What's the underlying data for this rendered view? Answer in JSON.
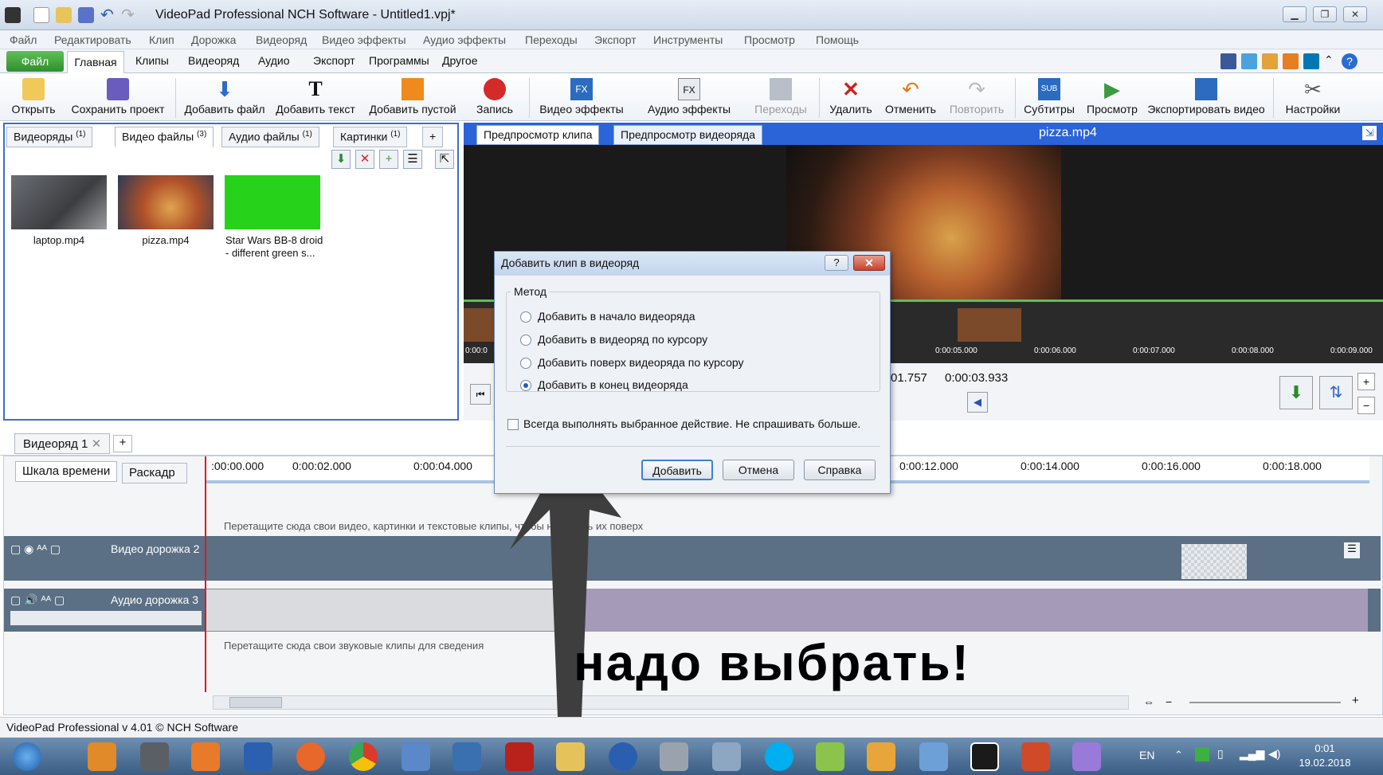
{
  "window": {
    "title": "VideoPad Professional NCH Software - Untitled1.vpj*"
  },
  "menu": [
    "Файл",
    "Редактировать",
    "Клип",
    "Дорожка",
    "Видеоряд",
    "Видео эффекты",
    "Аудио эффекты",
    "Переходы",
    "Экспорт",
    "Инструменты",
    "Просмотр",
    "Помощь"
  ],
  "ribbon_tabs": {
    "file": "Файл",
    "home": "Главная",
    "items": [
      "Клипы",
      "Видеоряд",
      "Аудио",
      "Экспорт",
      "Программы",
      "Другое"
    ]
  },
  "toolbar": {
    "open": "Открыть",
    "save": "Сохранить проект",
    "add_file": "Добавить файл",
    "add_text": "Добавить текст",
    "add_blank": "Добавить пустой",
    "record": "Запись",
    "video_fx": "Видео эффекты",
    "audio_fx": "Аудио эффекты",
    "transitions": "Переходы",
    "delete": "Удалить",
    "undo": "Отменить",
    "redo": "Повторить",
    "subtitles": "Субтитры",
    "preview": "Просмотр",
    "export": "Экспортировать видео",
    "settings": "Настройки"
  },
  "bin": {
    "tabs": [
      {
        "label": "Видеоряды",
        "count": "(1)"
      },
      {
        "label": "Видео файлы",
        "count": "(3)"
      },
      {
        "label": "Аудио файлы",
        "count": "(1)"
      },
      {
        "label": "Картинки",
        "count": "(1)"
      }
    ],
    "add_tab": "+",
    "files": [
      "laptop.mp4",
      "pizza.mp4",
      "Star Wars BB-8 droid - different green s..."
    ]
  },
  "preview": {
    "tab_clip": "Предпросмотр клипа",
    "tab_sequence": "Предпросмотр видеоряда",
    "file": "pizza.mp4",
    "ruler": [
      "0:00:0",
      "0:00:05.000",
      "0:00:06.000",
      "0:00:07.000",
      "0:00:08.000",
      "0:00:09.000"
    ],
    "time_current": "01.757",
    "time_total": "0:00:03.933"
  },
  "sequence": {
    "tab": "Видеоряд 1",
    "add": "+"
  },
  "timeline": {
    "tab_timeline": "Шкала времени",
    "tab_storyboard": "Раскадр",
    "ticks": [
      ":00:00.000",
      "0:00:02.000",
      "0:00:04.000",
      "0:00:12.000",
      "0:00:14.000",
      "0:00:16.000",
      "0:00:18.000"
    ],
    "overlay_hint": "Перетащите сюда свои видео, картинки и текстовые клипы, чтобы наложить их поверх",
    "video_track": "Видео дорожка 2",
    "audio_track": "Аудио дорожка 3",
    "audio_hint": "Перетащите сюда свои звуковые клипы для сведения"
  },
  "dialog": {
    "title": "Добавить клип в видеоряд",
    "help": "?",
    "group": "Метод",
    "options": [
      "Добавить в начало видеоряда",
      "Добавить в видеоряд по курсору",
      "Добавить поверх видеоряда по курсору",
      "Добавить в конец видеоряда"
    ],
    "selected_option": 3,
    "checkbox": "Всегда выполнять выбранное действие. Не спрашивать больше.",
    "btn_add": "Добавить",
    "btn_cancel": "Отмена",
    "btn_help": "Справка"
  },
  "annotation": "надо  выбрать!",
  "status": "VideoPad Professional v 4.01 © NCH Software",
  "taskbar": {
    "lang": "EN",
    "time": "0:01",
    "date": "19.02.2018"
  },
  "colors": {
    "accent": "#2b63d8",
    "green": "#3fa33a",
    "track": "#5b7085",
    "audio_clip": "#a59ab8"
  }
}
